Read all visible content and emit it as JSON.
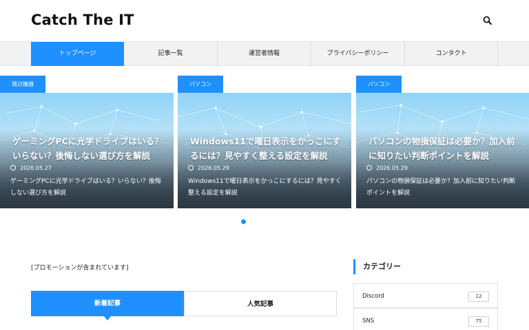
{
  "header": {
    "site_title": "Catch The IT",
    "search_icon": "search-icon"
  },
  "nav": {
    "items": [
      {
        "label": "トップページ",
        "active": true
      },
      {
        "label": "記事一覧",
        "active": false
      },
      {
        "label": "運営者情報",
        "active": false
      },
      {
        "label": "プライバシーポリシー",
        "active": false
      },
      {
        "label": "コンタクト",
        "active": false
      }
    ]
  },
  "slider": {
    "cards": [
      {
        "category": "周辺機器",
        "title": "ゲーミングPCに光学ドライブはいる？いらない？後悔しない選び方を解説",
        "date": "2026.05.27",
        "excerpt": "ゲーミングPCに光学ドライブはいる？いらない？後悔しない選び方を解説"
      },
      {
        "category": "パソコン",
        "title": "Windows11で曜日表示をかっこにするには？見やすく整える設定を解説",
        "date": "2026.05.29",
        "excerpt": "Windows11で曜日表示をかっこにするには？見やすく整える設定を解説"
      },
      {
        "category": "パソコン",
        "title": "パソコンの物損保証は必要か？加入前に知りたい判断ポイントを解説",
        "date": "2026.05.29",
        "excerpt": "パソコンの物損保証は必要か？加入前に知りたい判断ポイントを解説"
      }
    ],
    "accent_color": "#1e90ff"
  },
  "main": {
    "promo_text": "[プロモーションが含まれています]",
    "tabs": [
      {
        "label": "新着記事",
        "active": true
      },
      {
        "label": "人気記事",
        "active": false
      }
    ]
  },
  "sidebar": {
    "widget_title": "カテゴリー",
    "categories": [
      {
        "name": "Discord",
        "count": "12"
      },
      {
        "name": "SNS",
        "count": "75"
      }
    ]
  }
}
